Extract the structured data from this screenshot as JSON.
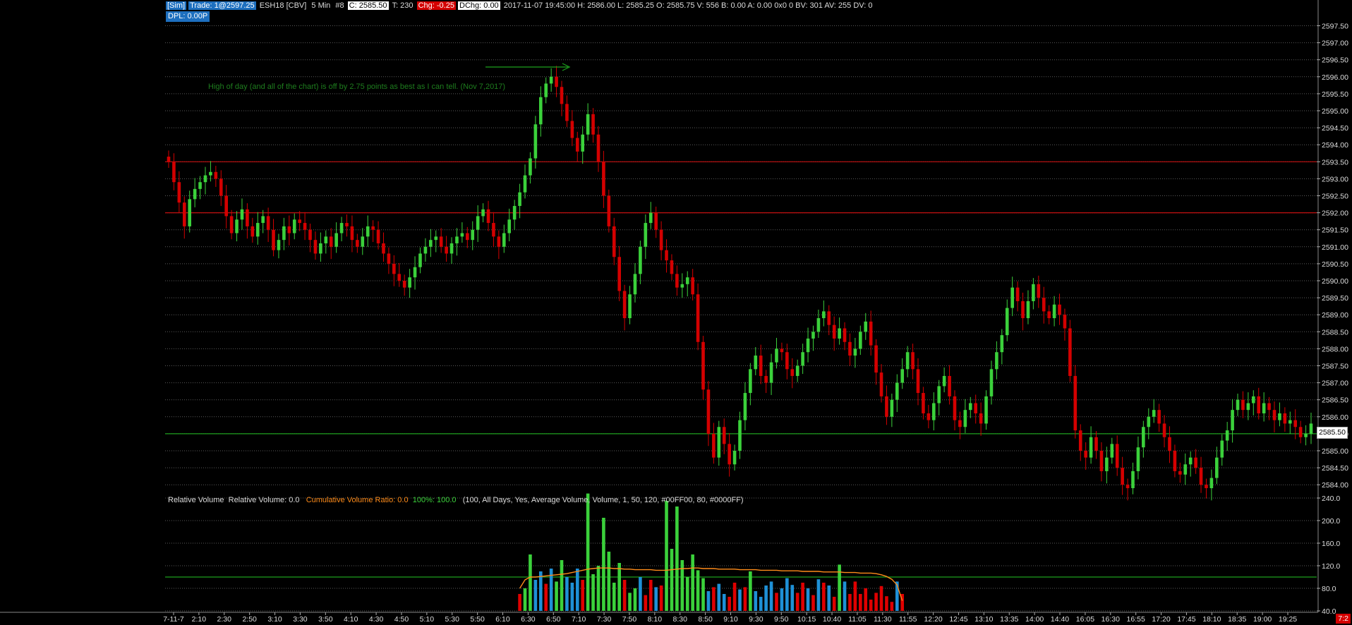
{
  "header": {
    "sim": "[Sim]",
    "trade": "Trade: 1@2597.25",
    "symbol": "ESH18 [CBV]",
    "interval": "5 Min",
    "bars": "#8",
    "close": "C: 2585.50",
    "ticks": "T: 230",
    "chg": "Chg: -0.25",
    "dchg": "DChg: 0.00",
    "details": "2017-11-07 19:45:00 H: 2586.00 L: 2585.25 O: 2585.75 V: 556 B: 0.00 A: 0.00 0x0 0 BV: 301 AV: 255 DV: 0",
    "dpl": "DPL: 0.00P"
  },
  "annotation": "High of day (and all of the chart) is off by 2.75 points as best as I can tell. (Nov 7,2017)",
  "study": {
    "name": "Relative Volume",
    "rv": "Relative Volume: 0.0",
    "cvr": "Cumulative Volume Ratio: 0.0",
    "pct": "100%: 100.0",
    "params": "(100, All Days, Yes, Average Volume, Volume, 1, 50, 120, #00FF00, 80, #0000FF)"
  },
  "last_price_label": "2585.50",
  "corner_label": "7:2",
  "colors": {
    "up": "#3bd13b",
    "down": "#d40000",
    "vol_up": "#3bd13b",
    "vol_down": "#e00000",
    "vol_neutral": "#1e90d6",
    "avg": "#ff8c1a",
    "grid": "#5a5a5a",
    "ref_red": "#c41010",
    "ref_green": "#1ea01e"
  },
  "chart_data": {
    "type": "candlestick",
    "price_axis": {
      "ylim": [
        2583.5,
        2598.0
      ],
      "ticks": [
        "2597.50",
        "2597.00",
        "2596.50",
        "2596.00",
        "2595.50",
        "2595.00",
        "2594.50",
        "2594.00",
        "2593.50",
        "2593.00",
        "2592.50",
        "2592.00",
        "2591.50",
        "2591.00",
        "2590.50",
        "2590.00",
        "2589.50",
        "2589.00",
        "2588.50",
        "2588.00",
        "2587.50",
        "2587.00",
        "2586.50",
        "2586.00",
        "2585.50",
        "2585.00",
        "2584.50",
        "2584.00"
      ]
    },
    "reference_lines": [
      {
        "price": 2593.5,
        "color": "red"
      },
      {
        "price": 2592.0,
        "color": "red"
      },
      {
        "price": 2585.5,
        "color": "green"
      }
    ],
    "time_labels": [
      "7-11-7",
      "2:10",
      "2:30",
      "2:50",
      "3:10",
      "3:30",
      "3:50",
      "4:10",
      "4:30",
      "4:50",
      "5:10",
      "5:30",
      "5:50",
      "6:10",
      "6:30",
      "6:50",
      "7:10",
      "7:30",
      "7:50",
      "8:10",
      "8:30",
      "8:50",
      "9:10",
      "9:30",
      "9:50",
      "10:15",
      "10:40",
      "11:05",
      "11:30",
      "11:55",
      "12:20",
      "12:45",
      "13:10",
      "13:35",
      "14:00",
      "14:40",
      "16:05",
      "16:30",
      "16:55",
      "17:20",
      "17:45",
      "18:10",
      "18:35",
      "19:00",
      "19:25"
    ],
    "closes": [
      2593.5,
      2592.9,
      2592.3,
      2591.6,
      2592.4,
      2592.7,
      2592.9,
      2593.1,
      2593.2,
      2593.0,
      2592.5,
      2591.9,
      2591.4,
      2591.8,
      2592.1,
      2591.6,
      2591.3,
      2591.7,
      2591.9,
      2591.5,
      2590.9,
      2591.2,
      2591.6,
      2591.4,
      2591.8,
      2591.7,
      2591.5,
      2591.2,
      2590.8,
      2591.1,
      2591.3,
      2591.0,
      2591.4,
      2591.7,
      2591.6,
      2591.2,
      2591.0,
      2591.3,
      2591.6,
      2591.5,
      2591.1,
      2590.8,
      2590.5,
      2590.2,
      2590.0,
      2589.8,
      2590.1,
      2590.4,
      2590.8,
      2591.0,
      2591.2,
      2591.3,
      2591.0,
      2590.8,
      2591.1,
      2591.3,
      2591.4,
      2591.2,
      2591.5,
      2591.9,
      2592.1,
      2591.7,
      2591.3,
      2591.0,
      2591.4,
      2591.8,
      2592.2,
      2592.6,
      2593.1,
      2593.6,
      2594.6,
      2595.4,
      2595.8,
      2596.0,
      2595.7,
      2595.2,
      2594.7,
      2594.2,
      2593.8,
      2594.3,
      2594.9,
      2594.3,
      2593.5,
      2592.5,
      2591.6,
      2590.7,
      2589.7,
      2588.9,
      2589.6,
      2590.2,
      2591.0,
      2591.7,
      2592.0,
      2591.5,
      2590.9,
      2590.6,
      2590.2,
      2589.8,
      2589.9,
      2590.1,
      2589.6,
      2588.2,
      2586.8,
      2585.5,
      2584.8,
      2585.7,
      2585.2,
      2584.6,
      2585.0,
      2585.9,
      2586.7,
      2587.4,
      2587.8,
      2587.2,
      2587.0,
      2587.6,
      2588.0,
      2587.9,
      2587.4,
      2587.2,
      2587.5,
      2587.9,
      2588.3,
      2588.5,
      2588.9,
      2589.1,
      2588.7,
      2588.3,
      2588.6,
      2588.2,
      2587.8,
      2588.0,
      2588.5,
      2588.8,
      2588.1,
      2587.3,
      2586.6,
      2586.0,
      2586.5,
      2587.0,
      2587.4,
      2587.9,
      2587.4,
      2586.7,
      2586.1,
      2585.9,
      2586.4,
      2586.9,
      2587.2,
      2586.6,
      2585.9,
      2585.7,
      2586.2,
      2586.4,
      2586.1,
      2585.8,
      2586.6,
      2587.4,
      2587.9,
      2588.4,
      2589.2,
      2589.8,
      2589.4,
      2588.9,
      2589.4,
      2589.9,
      2589.5,
      2589.1,
      2588.9,
      2589.3,
      2589.0,
      2588.6,
      2587.2,
      2585.6,
      2585.0,
      2584.8,
      2585.4,
      2585.0,
      2584.4,
      2584.8,
      2585.2,
      2584.5,
      2584.0,
      2583.9,
      2584.4,
      2585.1,
      2585.7,
      2586.0,
      2586.2,
      2585.8,
      2585.4,
      2585.0,
      2584.4,
      2584.3,
      2584.6,
      2584.8,
      2584.5,
      2584.0,
      2583.9,
      2584.2,
      2584.8,
      2585.3,
      2585.6,
      2586.2,
      2586.5,
      2586.2,
      2586.4,
      2586.6,
      2586.1,
      2586.4,
      2586.2,
      2585.9,
      2586.1,
      2585.8,
      2585.9,
      2585.7,
      2585.4,
      2585.5,
      2585.8
    ],
    "volume_axis": {
      "ylim": [
        40,
        260
      ],
      "ticks": [
        "240.0",
        "200.0",
        "160.0",
        "120.0",
        "80.0",
        "40.0"
      ]
    },
    "volume_threshold": 100,
    "volume_session": [
      {
        "v": 70,
        "c": "d"
      },
      {
        "v": 80,
        "c": "u"
      },
      {
        "v": 140,
        "c": "u"
      },
      {
        "v": 95,
        "c": "n"
      },
      {
        "v": 110,
        "c": "n"
      },
      {
        "v": 88,
        "c": "d"
      },
      {
        "v": 115,
        "c": "n"
      },
      {
        "v": 92,
        "c": "u"
      },
      {
        "v": 130,
        "c": "u"
      },
      {
        "v": 100,
        "c": "n"
      },
      {
        "v": 90,
        "c": "n"
      },
      {
        "v": 115,
        "c": "n"
      },
      {
        "v": 95,
        "c": "d"
      },
      {
        "v": 248,
        "c": "u"
      },
      {
        "v": 105,
        "c": "u"
      },
      {
        "v": 120,
        "c": "u"
      },
      {
        "v": 205,
        "c": "u"
      },
      {
        "v": 145,
        "c": "u"
      },
      {
        "v": 90,
        "c": "u"
      },
      {
        "v": 125,
        "c": "u"
      },
      {
        "v": 95,
        "c": "d"
      },
      {
        "v": 72,
        "c": "u"
      },
      {
        "v": 80,
        "c": "u"
      },
      {
        "v": 100,
        "c": "n"
      },
      {
        "v": 68,
        "c": "d"
      },
      {
        "v": 95,
        "c": "d"
      },
      {
        "v": 82,
        "c": "n"
      },
      {
        "v": 85,
        "c": "d"
      },
      {
        "v": 235,
        "c": "u"
      },
      {
        "v": 150,
        "c": "u"
      },
      {
        "v": 225,
        "c": "u"
      },
      {
        "v": 130,
        "c": "u"
      },
      {
        "v": 100,
        "c": "u"
      },
      {
        "v": 140,
        "c": "u"
      },
      {
        "v": 112,
        "c": "u"
      },
      {
        "v": 98,
        "c": "u"
      },
      {
        "v": 75,
        "c": "n"
      },
      {
        "v": 82,
        "c": "d"
      },
      {
        "v": 88,
        "c": "n"
      },
      {
        "v": 70,
        "c": "n"
      },
      {
        "v": 65,
        "c": "d"
      },
      {
        "v": 90,
        "c": "d"
      },
      {
        "v": 78,
        "c": "n"
      },
      {
        "v": 82,
        "c": "d"
      },
      {
        "v": 110,
        "c": "u"
      },
      {
        "v": 75,
        "c": "n"
      },
      {
        "v": 65,
        "c": "n"
      },
      {
        "v": 85,
        "c": "n"
      },
      {
        "v": 92,
        "c": "n"
      },
      {
        "v": 72,
        "c": "d"
      },
      {
        "v": 80,
        "c": "n"
      },
      {
        "v": 98,
        "c": "n"
      },
      {
        "v": 86,
        "c": "n"
      },
      {
        "v": 72,
        "c": "d"
      },
      {
        "v": 90,
        "c": "d"
      },
      {
        "v": 80,
        "c": "n"
      },
      {
        "v": 68,
        "c": "d"
      },
      {
        "v": 96,
        "c": "n"
      },
      {
        "v": 90,
        "c": "d"
      },
      {
        "v": 85,
        "c": "n"
      },
      {
        "v": 65,
        "c": "d"
      },
      {
        "v": 122,
        "c": "u"
      },
      {
        "v": 92,
        "c": "n"
      },
      {
        "v": 70,
        "c": "d"
      },
      {
        "v": 92,
        "c": "d"
      },
      {
        "v": 70,
        "c": "d"
      },
      {
        "v": 80,
        "c": "d"
      },
      {
        "v": 60,
        "c": "d"
      },
      {
        "v": 72,
        "c": "d"
      },
      {
        "v": 84,
        "c": "d"
      },
      {
        "v": 66,
        "c": "d"
      },
      {
        "v": 56,
        "c": "d"
      },
      {
        "v": 92,
        "c": "n"
      },
      {
        "v": 70,
        "c": "d"
      }
    ],
    "volume_average": [
      80,
      95,
      100,
      100,
      101,
      102,
      103,
      104,
      105,
      106,
      108,
      110,
      112,
      114,
      115,
      116,
      116,
      116,
      115,
      115,
      114,
      114,
      113,
      113,
      113,
      113,
      112,
      112,
      112,
      113,
      114,
      115,
      115,
      116,
      116,
      115,
      115,
      115,
      114,
      114,
      114,
      114,
      113,
      113,
      113,
      113,
      112,
      112,
      112,
      112,
      111,
      111,
      111,
      111,
      110,
      110,
      110,
      110,
      109,
      109,
      109,
      109,
      108,
      108,
      108,
      107,
      107,
      107,
      106,
      104,
      101,
      96,
      86,
      58
    ],
    "volume_start_bar": 67
  }
}
